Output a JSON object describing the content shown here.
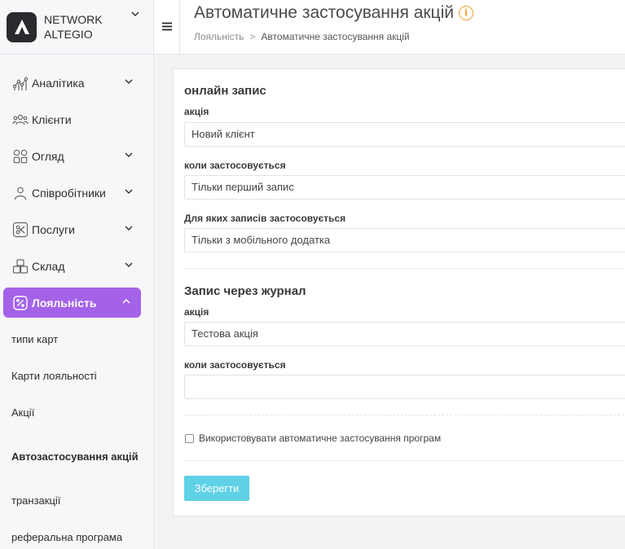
{
  "brand": {
    "name_line1": "NETWORK",
    "name_line2": "ALTEGIO"
  },
  "sidebar": {
    "items": [
      {
        "label": "Аналітика",
        "icon": "analytics-icon",
        "has_chevron": true
      },
      {
        "label": "Клієнти",
        "icon": "clients-icon",
        "has_chevron": false
      },
      {
        "label": "Огляд",
        "icon": "overview-icon",
        "has_chevron": true
      },
      {
        "label": "Співробітники",
        "icon": "staff-icon",
        "has_chevron": true
      },
      {
        "label": "Послуги",
        "icon": "services-icon",
        "has_chevron": true
      },
      {
        "label": "Склад",
        "icon": "warehouse-icon",
        "has_chevron": true
      },
      {
        "label": "Лояльність",
        "icon": "loyalty-icon",
        "has_chevron": true,
        "active": true
      }
    ],
    "sub_items": [
      {
        "label": "типи карт"
      },
      {
        "label": "Карти лояльності"
      },
      {
        "label": "Акції"
      },
      {
        "label": "Автозастосування акцій",
        "active": true
      },
      {
        "label": "транзакції"
      },
      {
        "label": "реферальна програма"
      }
    ]
  },
  "header": {
    "title": "Автоматичне застосування акцій",
    "info_icon_glyph": "i",
    "breadcrumb": {
      "parent": "Лояльність",
      "separator": ">",
      "current": "Автоматичне застосування акцій"
    }
  },
  "form": {
    "online": {
      "title": "онлайн запис",
      "promo_label": "акція",
      "promo_value": "Новий клієнт",
      "when_label": "коли застосовується",
      "when_value": "Тільки перший запис",
      "which_label": "Для яких записів застосовується",
      "which_value": "Тільки з мобільного додатка"
    },
    "journal": {
      "title": "Запис через журнал",
      "promo_label": "акція",
      "promo_value": "Тестова акція",
      "when_label": "коли застосовується",
      "when_value": ""
    },
    "checkbox_label": "Використовувати автоматичне застосування програм",
    "checkbox_checked": false,
    "save_label": "Зберегти"
  },
  "colors": {
    "accent": "#a462e9",
    "save_button": "#5fd1e6",
    "info": "#f0a030"
  }
}
